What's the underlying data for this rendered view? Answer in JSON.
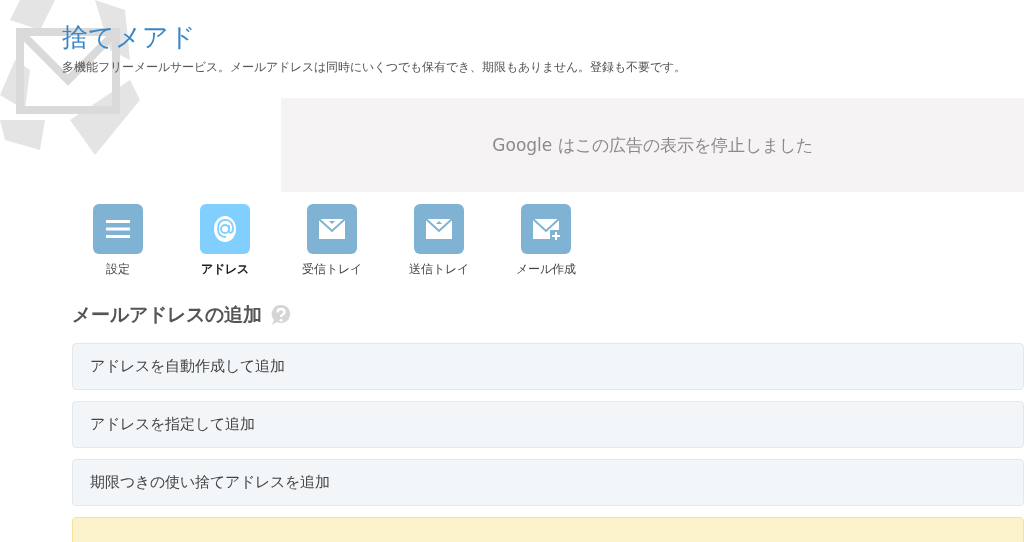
{
  "header": {
    "title": "捨てメアド",
    "subtitle": "多機能フリーメールサービス。メールアドレスは同時にいくつでも保有でき、期限もありません。登録も不要です。"
  },
  "ad": {
    "message": "Google はこの広告の表示を停止しました"
  },
  "nav": [
    {
      "label": "設定",
      "kind": "menu",
      "selected": false
    },
    {
      "label": "アドレス",
      "kind": "at",
      "selected": true
    },
    {
      "label": "受信トレイ",
      "kind": "inbox",
      "selected": false
    },
    {
      "label": "送信トレイ",
      "kind": "outbox",
      "selected": false
    },
    {
      "label": "メール作成",
      "kind": "compose",
      "selected": false
    }
  ],
  "section": {
    "heading": "メールアドレスの追加",
    "panels": [
      {
        "label": "アドレスを自動作成して追加",
        "kind": "plain"
      },
      {
        "label": "アドレスを指定して追加",
        "kind": "plain"
      },
      {
        "label": "期限つきの使い捨てアドレスを追加",
        "kind": "plain"
      },
      {
        "kind": "notice"
      }
    ]
  }
}
